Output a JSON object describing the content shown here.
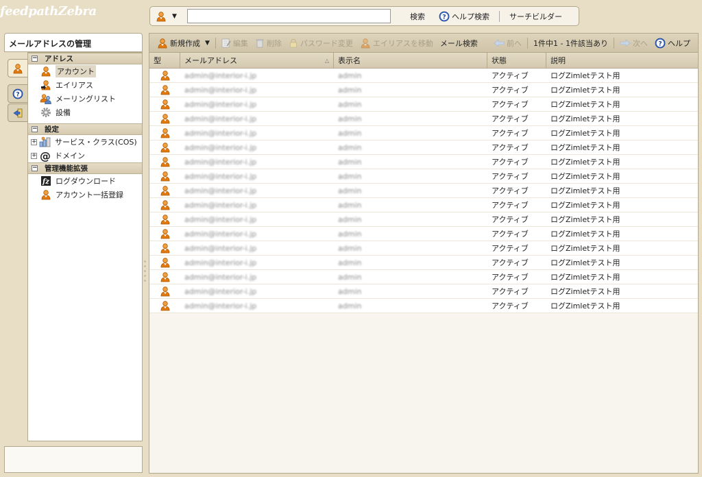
{
  "app": {
    "logo": "feedpathZebra"
  },
  "search": {
    "input_value": "",
    "search_label": "検索",
    "help_search_label": "ヘルプ検索",
    "search_builder_label": "サーチビルダー"
  },
  "left": {
    "title": "メールアドレスの管理",
    "sections": [
      {
        "label": "アドレス",
        "items": [
          {
            "label": "アカウント",
            "icon": "user-icon"
          },
          {
            "label": "エイリアス",
            "icon": "alias-icon"
          },
          {
            "label": "メーリングリスト",
            "icon": "group-icon"
          },
          {
            "label": "設備",
            "icon": "gear-icon"
          }
        ]
      },
      {
        "label": "設定",
        "items": [
          {
            "label": "サービス・クラス(COS)",
            "icon": "cos-icon"
          },
          {
            "label": "ドメイン",
            "icon": "at-icon"
          }
        ]
      },
      {
        "label": "管理機能拡張",
        "items": [
          {
            "label": "ログダウンロード",
            "icon": "zimlet-icon"
          },
          {
            "label": "アカウント一括登録",
            "icon": "user-icon"
          }
        ]
      }
    ]
  },
  "toolbar": {
    "new_label": "新規作成",
    "edit_label": "編集",
    "delete_label": "削除",
    "password_label": "パスワード変更",
    "move_alias_label": "エイリアスを移動",
    "mail_search_label": "メール検索",
    "prev_label": "前へ",
    "page_info": "1件中1 - 1件該当あり",
    "next_label": "次へ",
    "help_label": "ヘルプ"
  },
  "table": {
    "headers": {
      "type": "型",
      "email": "メールアドレス",
      "display_name": "表示名",
      "status": "状態",
      "description": "説明"
    },
    "rows": [
      {
        "email": "admin@interior-i.jp",
        "name": "admin",
        "status": "アクティブ",
        "desc": "ログZimletテスト用"
      },
      {
        "email": "admin@interior-i.jp",
        "name": "admin",
        "status": "アクティブ",
        "desc": "ログZimletテスト用"
      },
      {
        "email": "admin@interior-i.jp",
        "name": "admin",
        "status": "アクティブ",
        "desc": "ログZimletテスト用"
      },
      {
        "email": "admin@interior-i.jp",
        "name": "admin",
        "status": "アクティブ",
        "desc": "ログZimletテスト用"
      },
      {
        "email": "admin@interior-i.jp",
        "name": "admin",
        "status": "アクティブ",
        "desc": "ログZimletテスト用"
      },
      {
        "email": "admin@interior-i.jp",
        "name": "admin",
        "status": "アクティブ",
        "desc": "ログZimletテスト用"
      },
      {
        "email": "admin@interior-i.jp",
        "name": "admin",
        "status": "アクティブ",
        "desc": "ログZimletテスト用"
      },
      {
        "email": "admin@interior-i.jp",
        "name": "admin",
        "status": "アクティブ",
        "desc": "ログZimletテスト用"
      },
      {
        "email": "admin@interior-i.jp",
        "name": "admin",
        "status": "アクティブ",
        "desc": "ログZimletテスト用"
      },
      {
        "email": "admin@interior-i.jp",
        "name": "admin",
        "status": "アクティブ",
        "desc": "ログZimletテスト用"
      },
      {
        "email": "admin@interior-i.jp",
        "name": "admin",
        "status": "アクティブ",
        "desc": "ログZimletテスト用"
      },
      {
        "email": "admin@interior-i.jp",
        "name": "admin",
        "status": "アクティブ",
        "desc": "ログZimletテスト用"
      },
      {
        "email": "admin@interior-i.jp",
        "name": "admin",
        "status": "アクティブ",
        "desc": "ログZimletテスト用"
      },
      {
        "email": "admin@interior-i.jp",
        "name": "admin",
        "status": "アクティブ",
        "desc": "ログZimletテスト用"
      },
      {
        "email": "admin@interior-i.jp",
        "name": "admin",
        "status": "アクティブ",
        "desc": "ログZimletテスト用"
      },
      {
        "email": "admin@interior-i.jp",
        "name": "admin",
        "status": "アクティブ",
        "desc": "ログZimletテスト用"
      },
      {
        "email": "admin@interior-i.jp",
        "name": "admin",
        "status": "アクティブ",
        "desc": "ログZimletテスト用"
      }
    ]
  },
  "colors": {
    "accent": "#e8dec6",
    "user_icon": "#e07a10",
    "help_icon": "#2a5db0"
  }
}
